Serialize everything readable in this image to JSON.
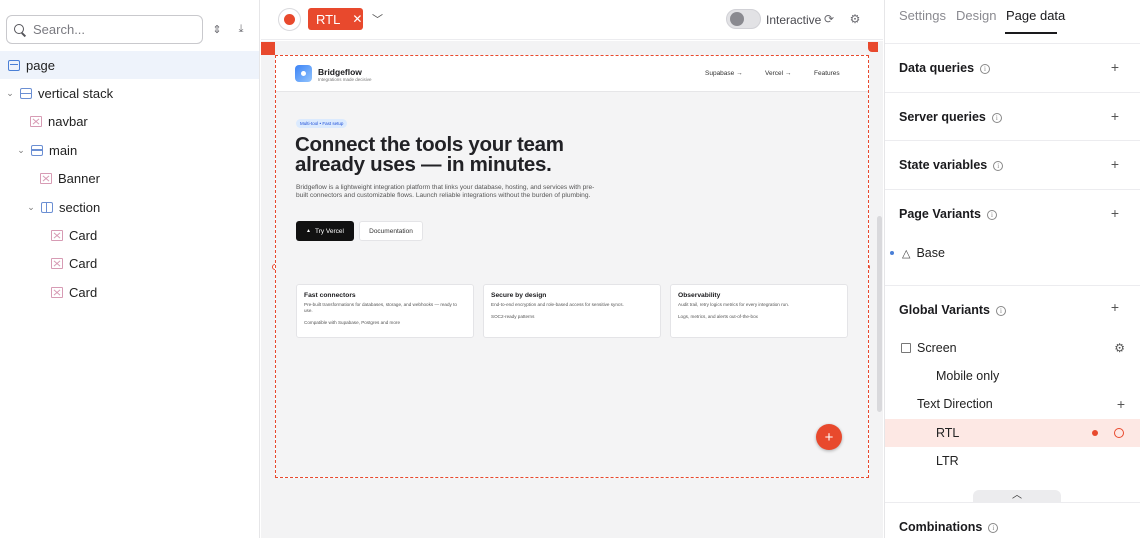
{
  "left_panel": {
    "search_placeholder": "Search...",
    "tree": [
      {
        "label": "page"
      },
      {
        "label": "vertical stack"
      },
      {
        "label": "navbar"
      },
      {
        "label": "main"
      },
      {
        "label": "Banner"
      },
      {
        "label": "section"
      },
      {
        "label": "Card"
      },
      {
        "label": "Card"
      },
      {
        "label": "Card"
      }
    ]
  },
  "toolbar": {
    "variant_chip": "RTL",
    "chip_close": "✕",
    "interactive_label": "Interactive"
  },
  "preview": {
    "brand": "Bridgeflow",
    "brand_sub": "Integrations made decisive",
    "nav_links": [
      "Supabase →",
      "Vercel →",
      "Features"
    ],
    "badge": "Multi-tool • Fast setup",
    "hero_title": "Connect the tools your team already uses — in minutes.",
    "hero_desc": "Bridgeflow is a lightweight integration platform that links your database, hosting, and services with pre-built connectors and customizable flows. Launch reliable integrations without the burden of plumbing.",
    "primary_button": "Try Vercel",
    "secondary_button": "Documentation",
    "cards": [
      {
        "title": "Fast connectors",
        "desc": "Pre-built transformations for databases, storage, and webhooks — ready to use.",
        "foot": "Compatible with Supabase, Postgres and more"
      },
      {
        "title": "Secure by design",
        "desc": "End-to-end encryption and role-based access for sensitive syncs.",
        "foot": "SOC2-ready patterns"
      },
      {
        "title": "Observability",
        "desc": "Audit trail, retry logics metrics for every integration run.",
        "foot": "Logs, metrics, and alerts out-of-the-box"
      }
    ],
    "fab": "+"
  },
  "right_panel": {
    "tabs": [
      "Settings",
      "Design",
      "Page data"
    ],
    "active_tab": "Page data",
    "sections": {
      "data_queries": "Data queries",
      "server_queries": "Server queries",
      "state_variables": "State variables",
      "page_variants": "Page Variants",
      "global_variants": "Global Variants",
      "combinations": "Combinations"
    },
    "page_variant_items": [
      "Base"
    ],
    "global_variant_items": {
      "screen": "Screen",
      "mobile_only": "Mobile only",
      "text_direction": "Text Direction",
      "rtl": "RTL",
      "ltr": "LTR"
    }
  },
  "colors": {
    "accent": "#e8492d",
    "selection": "#eef3fb",
    "rtl_highlight": "#fde8e4"
  }
}
